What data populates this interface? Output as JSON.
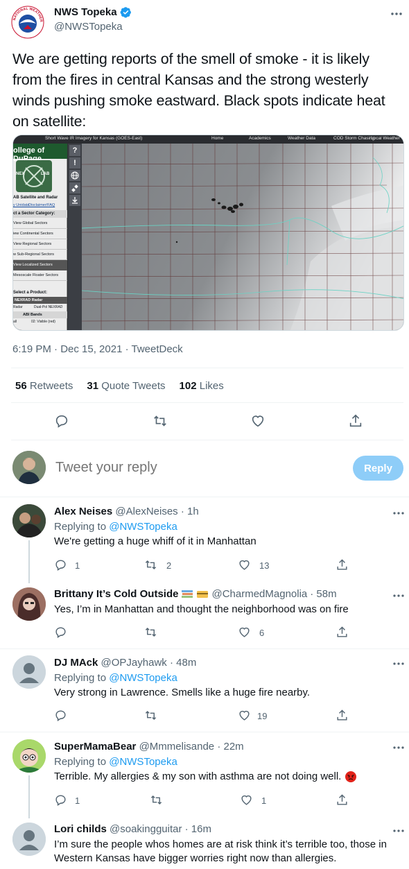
{
  "tweet": {
    "author_name": "NWS Topeka",
    "handle": "@NWSTopeka",
    "text": "We are getting reports of the smell of smoke - it is likely from the fires in central Kansas and the strong westerly winds pushing smoke eastward. Black spots indicate heat on satellite:",
    "timestamp": "6:19 PM · Dec 15, 2021 · TweetDeck",
    "stats": {
      "retweets_count": "56",
      "retweets_label": "Retweets",
      "quotes_count": "31",
      "quotes_label": "Quote Tweets",
      "likes_count": "102",
      "likes_label": "Likes"
    },
    "logo_text": "NATIONAL WEATHER SERVICE"
  },
  "media": {
    "title": "Short Wave IR Imagery for Kansas (GOES-East)",
    "nav": [
      "Home",
      "Academics",
      "Weather Data",
      "COD Storm Chasing",
      "Local Weather"
    ],
    "brand": "ollege of DuPage",
    "lab_text_left": "NEX",
    "lab_text_right": "LAB",
    "sidebar_heading": "AB Satellite and Radar",
    "sidebar_links": [
      "y Unidata",
      "Disclaimer/FAQ"
    ],
    "sector_heading": "ct a Sector Category:",
    "sectors": [
      "View Global Sectors",
      "iew Continental Sectors",
      "View Regional Sectors",
      "w Sub-Regional Sectors",
      "View Localized Sectors",
      "Mesoscale Floater Sectors"
    ],
    "selected_sector_index": 4,
    "product_heading": "Select a Product:",
    "nexrad": "NEXRAD Radar",
    "radar_opts": [
      "Radar",
      "Dual-Pol NEXRAD"
    ],
    "abi": "ABI Bands",
    "band_opts": [
      "all",
      "02: Visible (red)"
    ],
    "tool_icons": [
      "?",
      "!"
    ]
  },
  "composer": {
    "placeholder": "Tweet your reply",
    "button": "Reply"
  },
  "replies": [
    {
      "name": "Alex Neises",
      "handle": "@AlexNeises",
      "time": "· 1h",
      "replying_label": "Replying to",
      "replying_to": "@NWSTopeka",
      "text": "We're getting a huge whiff of it in Manhattan",
      "replies": "1",
      "retweets": "2",
      "likes": "13"
    },
    {
      "name": "Brittany It’s Cold Outside",
      "handle": "@CharmedMagnolia",
      "time": "· 58m",
      "text": "Yes, I’m in Manhattan and thought the neighborhood was on fire",
      "replies": "",
      "retweets": "",
      "likes": "6"
    },
    {
      "name": "DJ MAck",
      "handle": "@OPJayhawk",
      "time": "· 48m",
      "replying_label": "Replying to",
      "replying_to": "@NWSTopeka",
      "text": "Very strong in Lawrence. Smells like a huge fire nearby.",
      "replies": "",
      "retweets": "",
      "likes": "19"
    },
    {
      "name": "SuperMamaBear",
      "handle": "@Mmmelisande",
      "time": "· 22m",
      "replying_label": "Replying to",
      "replying_to": "@NWSTopeka",
      "text": "Terrible. My allergies & my son with asthma are not doing well.",
      "replies": "1",
      "retweets": "",
      "likes": "1"
    },
    {
      "name": "Lori childs",
      "handle": "@soakingguitar",
      "time": "· 16m",
      "text": "I’m sure the people whos homes are at risk think it’s terrible too, those in Western Kansas have bigger worries right now than allergies."
    }
  ],
  "colors": {
    "accent": "#1d9bf0",
    "text": "#0f1419",
    "muted": "#536471",
    "like_red": "#f91880"
  }
}
